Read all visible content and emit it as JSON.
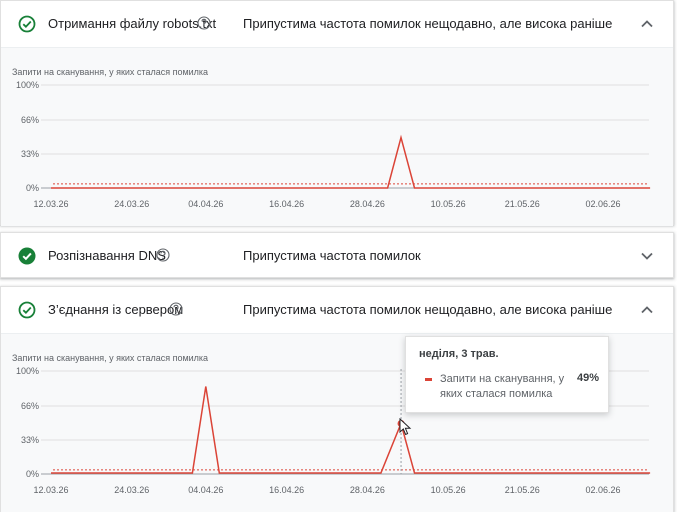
{
  "panels": [
    {
      "title": "Отримання файлу robots.txt",
      "status": "Припустима частота помилок нещодавно, але висока раніше",
      "icon": "check-circle-outline-icon",
      "expanded": true
    },
    {
      "title": "Розпізнавання DNS",
      "status": "Припустима частота помилок",
      "icon": "check-circle-filled-icon",
      "expanded": false
    },
    {
      "title": "З’єднання із сервером",
      "status": "Припустима частота помилок нещодавно, але висока раніше",
      "icon": "check-circle-outline-icon",
      "expanded": true
    }
  ],
  "colors": {
    "line": "#db4437",
    "threshold": "#db4437",
    "success_green": "#188038",
    "grid": "#e0e0e0"
  },
  "chart_data": [
    {
      "type": "line",
      "ylabel": "Запити на сканування, у яких сталася помилка",
      "ylim": [
        0,
        100
      ],
      "y_ticks": [
        "100%",
        "66%",
        "33%",
        "0%"
      ],
      "y_tick_values": [
        100,
        66,
        33,
        0
      ],
      "x_tick_labels": [
        "12.03.26",
        "24.03.26",
        "04.04.26",
        "16.04.26",
        "28.04.26",
        "10.05.26",
        "21.05.26",
        "02.06.26"
      ],
      "x_range": [
        "12.03.26",
        "09.06.26"
      ],
      "threshold": 4,
      "series": [
        {
          "x": [
            "12.03.26",
            "01.05.26",
            "03.05.26",
            "05.05.26",
            "09.06.26"
          ],
          "values": [
            0,
            0,
            49,
            0,
            0
          ]
        }
      ]
    },
    {
      "type": "line",
      "ylabel": "Запити на сканування, у яких сталася помилка",
      "ylim": [
        0,
        100
      ],
      "y_ticks": [
        "100%",
        "66%",
        "33%",
        "0%"
      ],
      "y_tick_values": [
        100,
        66,
        33,
        0
      ],
      "x_tick_labels": [
        "12.03.26",
        "24.03.26",
        "04.04.26",
        "16.04.26",
        "28.04.26",
        "10.05.26",
        "21.05.26",
        "02.06.26"
      ],
      "x_range": [
        "12.03.26",
        "09.06.26"
      ],
      "threshold": 4,
      "series": [
        {
          "x": [
            "12.03.26",
            "02.04.26",
            "04.04.26",
            "06.04.26",
            "30.04.26",
            "03.05.26",
            "05.05.26",
            "09.06.26"
          ],
          "values": [
            1,
            1,
            85,
            1,
            1,
            49,
            1,
            1
          ]
        }
      ],
      "tooltip": {
        "date": "неділя, 3 трав.",
        "label": "Запити на сканування, у яких сталася помилка",
        "value": "49%",
        "x": "03.05.26",
        "y": 49
      }
    }
  ]
}
